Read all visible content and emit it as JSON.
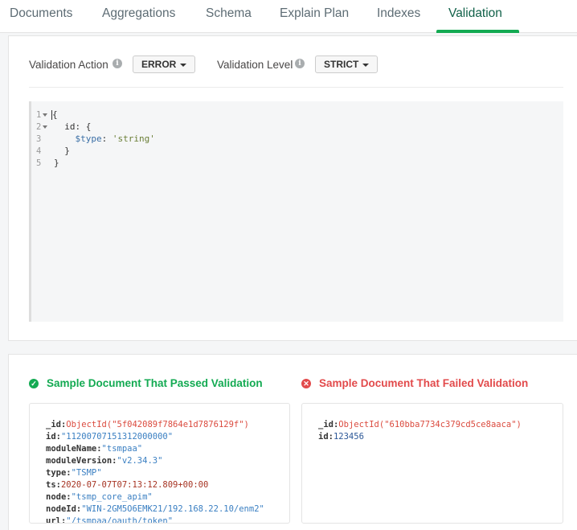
{
  "tabs": [
    {
      "label": "Documents"
    },
    {
      "label": "Aggregations"
    },
    {
      "label": "Schema"
    },
    {
      "label": "Explain Plan"
    },
    {
      "label": "Indexes"
    },
    {
      "label": "Validation"
    }
  ],
  "active_tab": "Validation",
  "validation": {
    "action_label": "Validation Action",
    "action_value": "ERROR",
    "level_label": "Validation Level",
    "level_value": "STRICT"
  },
  "editor": {
    "line_numbers": [
      "1",
      "2",
      "3",
      "4",
      "5"
    ],
    "lines": {
      "l1": "{",
      "l2_key": "id",
      "l2_rest": ": {",
      "l3_key": "$type",
      "l3_sep": ": ",
      "l3_val": "'string'",
      "l4": "}",
      "l5": "}"
    }
  },
  "passed": {
    "title": "Sample Document That Passed Validation",
    "fields": {
      "_id_key": "_id:",
      "_id_val": "ObjectId(\"5f042089f7864e1d7876129f\")",
      "id_key": "id:",
      "id_val": "\"11200707151312000000\"",
      "moduleName_key": "moduleName:",
      "moduleName_val": "\"tsmpaa\"",
      "moduleVersion_key": "moduleVersion:",
      "moduleVersion_val": "\"v2.34.3\"",
      "type_key": "type:",
      "type_val": "\"TSMP\"",
      "ts_key": "ts:",
      "ts_val": "2020-07-07T07:13:12.809+00:00",
      "node_key": "node:",
      "node_val": "\"tsmp_core_apim\"",
      "nodeId_key": "nodeId:",
      "nodeId_val": "\"WIN-2GM5O6EMK21/192.168.22.10/enm2\"",
      "url_key": "url:",
      "url_val": "\"/tsmpaa/oauth/token\""
    }
  },
  "failed": {
    "title": "Sample Document That Failed Validation",
    "fields": {
      "_id_key": "_id:",
      "_id_val": "ObjectId(\"610bba7734c379cd5ce8aaca\")",
      "id_key": "id:",
      "id_val": "123456"
    }
  },
  "colors": {
    "accent_green": "#13aa52",
    "active_tab_text": "#116149",
    "error_red": "#e24a4b"
  },
  "icons": {
    "info": "info-icon",
    "pass": "check-circle-icon",
    "fail": "x-circle-icon",
    "dropdown": "caret-down-icon",
    "fold": "fold-arrow-icon"
  }
}
